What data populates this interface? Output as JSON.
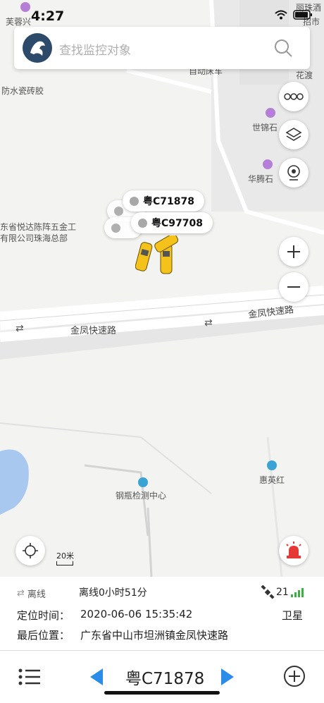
{
  "status_bar": {
    "time": "4:27"
  },
  "search": {
    "placeholder": "查找监控对象"
  },
  "map": {
    "pois": [
      "芙蓉兴",
      "丽珠酒",
      "招市",
      "花渡",
      "防水瓷砖胶",
      "世锦石",
      "华腾石",
      "东省悦达陈阵五金工",
      "有限公司珠海总部",
      "钢瓶检测中心",
      "惠英红"
    ],
    "roads": [
      "金凤快速路",
      "金凤快速路"
    ],
    "partial_label": "自动床车",
    "scale": "20米",
    "vehicles": [
      {
        "plate": "粤C71878"
      },
      {
        "plate": "粤C97708"
      }
    ]
  },
  "info_panel": {
    "status_label": "离线",
    "status_duration": "离线0小时51分",
    "satellite_count": "21",
    "time_label": "定位时间：",
    "time_value": "2020-06-06 15:35:42",
    "location_source": "卫星",
    "address_label": "最后位置：",
    "address_value": "广东省中山市坦洲镇金凤快速路"
  },
  "bottom_bar": {
    "current_plate": "粤C71878"
  },
  "colors": {
    "accent": "#2b8de8",
    "alarm": "#e53935",
    "signal": "#3cb043"
  }
}
